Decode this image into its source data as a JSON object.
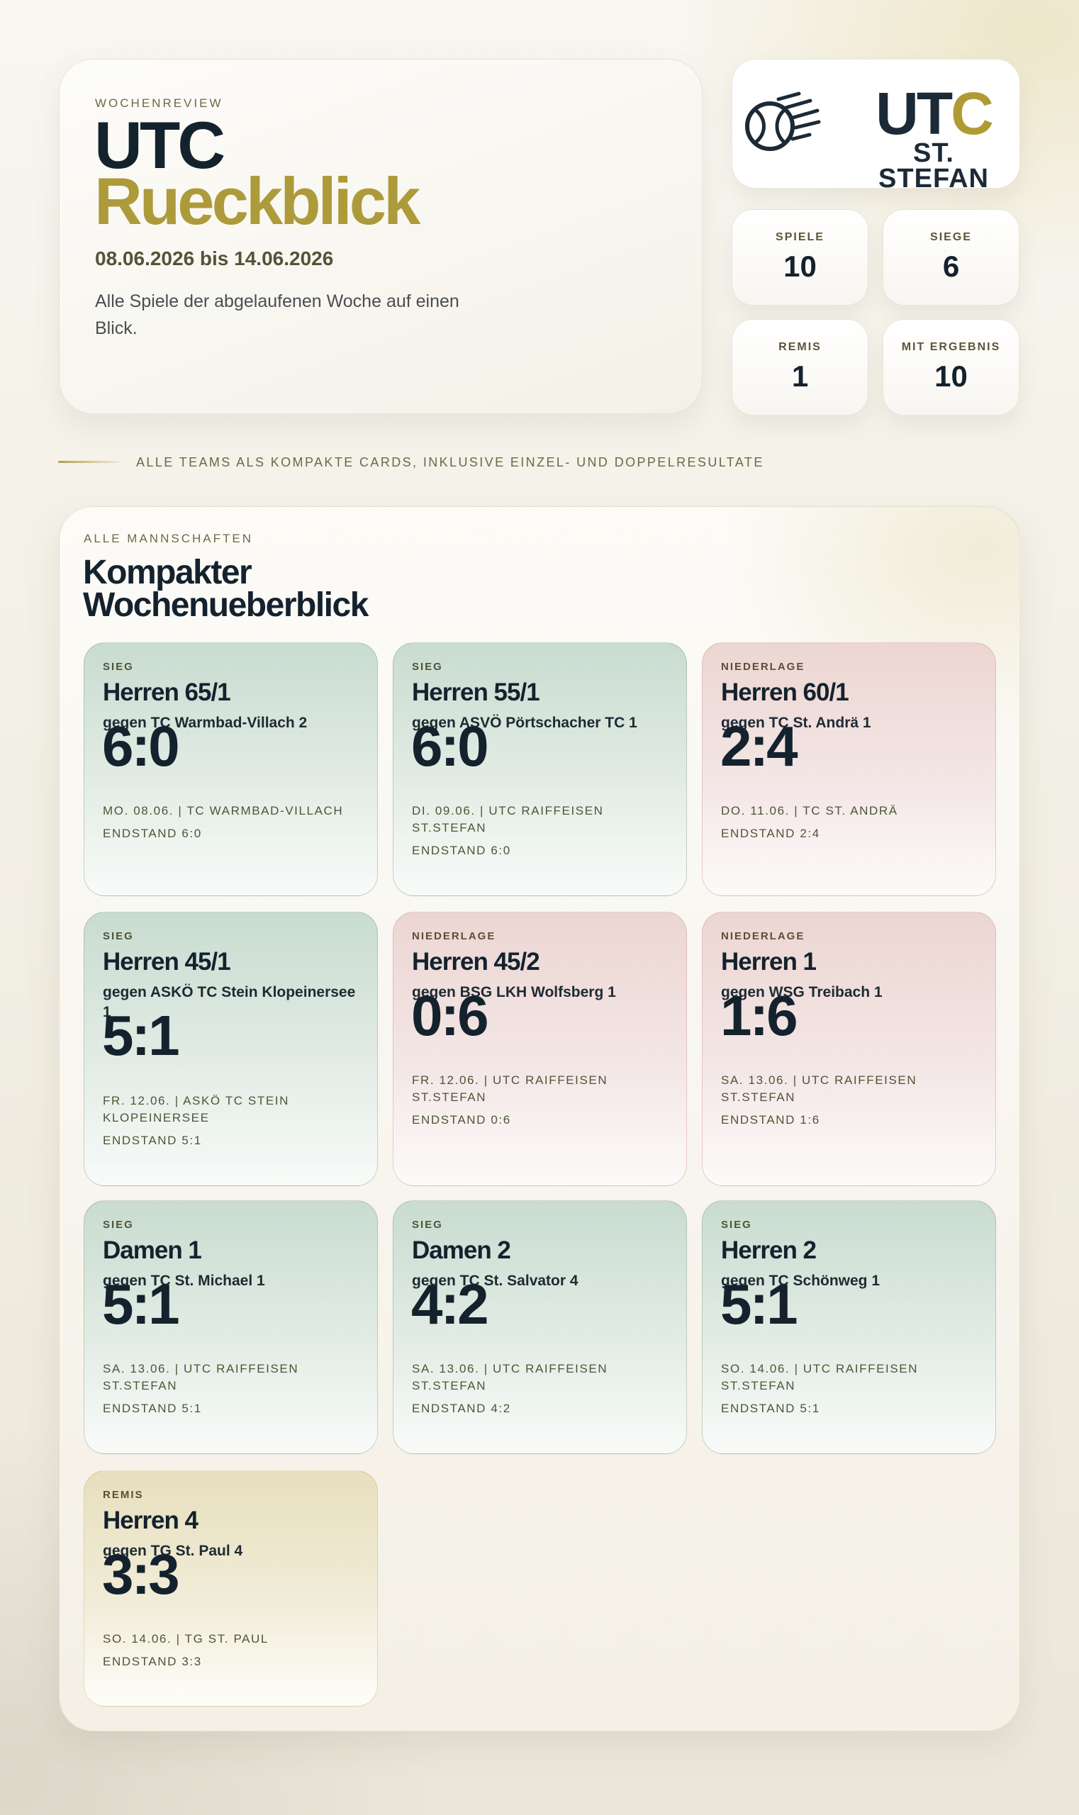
{
  "hero": {
    "kicker": "WOCHENREVIEW",
    "title_line1": "UTC",
    "title_line2": "Rueckblick",
    "date_range": "08.06.2026 bis 14.06.2026",
    "description": "Alle Spiele der abgelaufenen Woche auf einen Blick."
  },
  "logo": {
    "word_part1": "UT",
    "word_part2": "C",
    "subtitle": "ST. STEFAN",
    "icon": "tennis-ball-speed-icon",
    "colors": {
      "navy": "#1b2a36",
      "olive": "#4a5240",
      "gold": "#b09a34"
    }
  },
  "stats": [
    {
      "label": "SPIELE",
      "value": "10"
    },
    {
      "label": "SIEGE",
      "value": "6"
    },
    {
      "label": "REMIS",
      "value": "1"
    },
    {
      "label": "MIT ERGEBNIS",
      "value": "10"
    }
  ],
  "divider": {
    "text": "ALLE TEAMS ALS KOMPAKTE CARDS, INKLUSIVE EINZEL- UND DOPPELRESULTATE"
  },
  "panel": {
    "kicker": "ALLE MANNSCHAFTEN",
    "title": "Kompakter Wochenueberblick"
  },
  "status_colors": {
    "sieg": "#c9dcd0",
    "niederlage": "#ecd6d2",
    "remis": "#e7dfbd"
  },
  "matches": [
    {
      "status": "SIEG",
      "team": "Herren 65/1",
      "opponent": "gegen TC Warmbad-Villach 2",
      "score": "6:0",
      "info": "MO. 08.06. | TC WARMBAD-VILLACH",
      "final": "ENDSTAND 6:0"
    },
    {
      "status": "SIEG",
      "team": "Herren 55/1",
      "opponent": "gegen ASVÖ Pörtschacher TC 1",
      "score": "6:0",
      "info": "DI. 09.06. | UTC RAIFFEISEN ST.STEFAN",
      "final": "ENDSTAND 6:0"
    },
    {
      "status": "NIEDERLAGE",
      "team": "Herren 60/1",
      "opponent": "gegen TC St. Andrä 1",
      "score": "2:4",
      "info": "DO. 11.06. | TC ST. ANDRÄ",
      "final": "ENDSTAND 2:4"
    },
    {
      "status": "SIEG",
      "team": "Herren 45/1",
      "opponent": "gegen ASKÖ TC Stein Klopeinersee 1",
      "score": "5:1",
      "info": "FR. 12.06. | ASKÖ TC STEIN KLOPEINERSEE",
      "final": "ENDSTAND 5:1"
    },
    {
      "status": "NIEDERLAGE",
      "team": "Herren 45/2",
      "opponent": "gegen BSG LKH Wolfsberg 1",
      "score": "0:6",
      "info": "FR. 12.06. | UTC RAIFFEISEN ST.STEFAN",
      "final": "ENDSTAND 0:6"
    },
    {
      "status": "NIEDERLAGE",
      "team": "Herren 1",
      "opponent": "gegen WSG Treibach 1",
      "score": "1:6",
      "info": "SA. 13.06. | UTC RAIFFEISEN ST.STEFAN",
      "final": "ENDSTAND 1:6"
    },
    {
      "status": "SIEG",
      "team": "Damen 1",
      "opponent": "gegen TC St. Michael 1",
      "score": "5:1",
      "info": "SA. 13.06. | UTC RAIFFEISEN ST.STEFAN",
      "final": "ENDSTAND 5:1"
    },
    {
      "status": "SIEG",
      "team": "Damen 2",
      "opponent": "gegen TC St. Salvator 4",
      "score": "4:2",
      "info": "SA. 13.06. | UTC RAIFFEISEN ST.STEFAN",
      "final": "ENDSTAND 4:2"
    },
    {
      "status": "SIEG",
      "team": "Herren 2",
      "opponent": "gegen TC Schönweg 1",
      "score": "5:1",
      "info": "SO. 14.06. | UTC RAIFFEISEN ST.STEFAN",
      "final": "ENDSTAND 5:1"
    },
    {
      "status": "REMIS",
      "team": "Herren 4",
      "opponent": "gegen TG St. Paul 4",
      "score": "3:3",
      "info": "SO. 14.06. | TG ST. PAUL",
      "final": "ENDSTAND 3:3"
    }
  ]
}
